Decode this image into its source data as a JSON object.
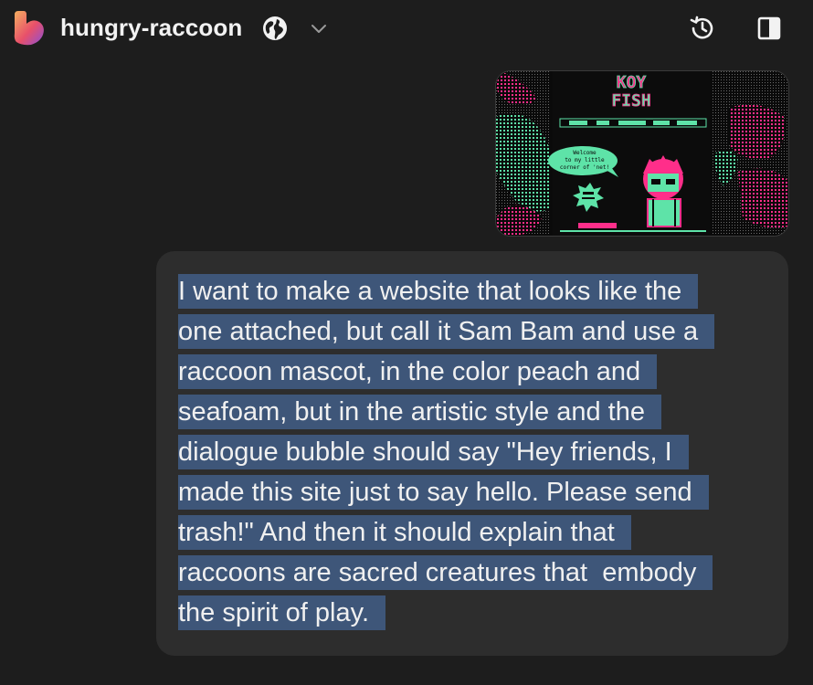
{
  "header": {
    "project_title": "hungry-raccoon",
    "icons": [
      "app-logo-icon",
      "globe-icon",
      "chevron-down-icon",
      "history-icon",
      "sidebar-panel-icon"
    ],
    "logo_colors": [
      "#f5b060",
      "#e8506a",
      "#8a4fd8"
    ]
  },
  "attachment": {
    "title_line1": "KOY",
    "title_line2": "FISH",
    "speech_text_1": "Welcome",
    "speech_text_2": "to my little",
    "speech_text_3": "corner of 'net!",
    "colors": {
      "pink": "#ff2e8a",
      "seafoam": "#5ee3a8",
      "background": "#0a0a0a"
    }
  },
  "message": {
    "lines": [
      "I want to make a website that looks like the",
      "one attached, but call it Sam Bam and use a",
      "raccoon mascot, in the color peach and",
      "seafoam, but in the artistic style and the",
      "dialogue bubble should say \"Hey friends, I",
      "made this site just to say hello. Please send",
      "trash!\" And then it should explain that",
      "raccoons are sacred creatures that  embody",
      "the spirit of play."
    ],
    "highlight_color": "#3e5679",
    "bubble_color": "#2d2d2d"
  }
}
